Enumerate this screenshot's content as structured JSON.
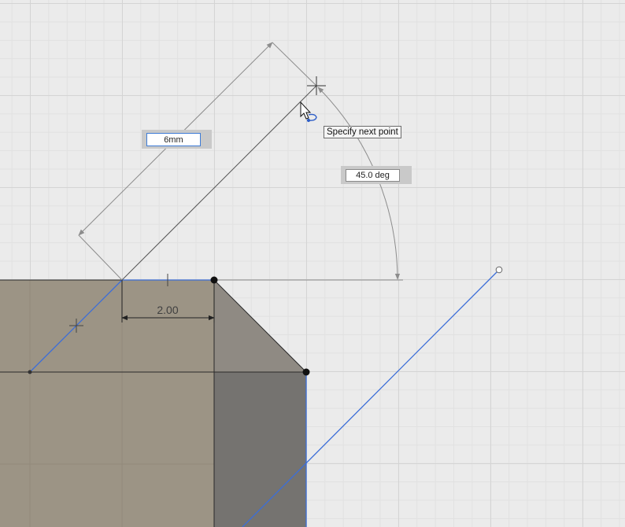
{
  "viewport": {
    "background_color": "#ebebeb",
    "body_face_color": "#988f7f",
    "side_face_color": "#757370",
    "chamfer_face_color": "#8f8a83",
    "sketch_line_color": "#3c6ed8",
    "dimension_line_color": "#8c8c8c"
  },
  "length_input": {
    "value": "6mm"
  },
  "angle_input": {
    "value": "45.0 deg"
  },
  "tooltip": {
    "text": "Specify next point"
  },
  "horizontal_dimension": {
    "label": "2.00"
  },
  "cursor": {
    "icon": "arrow-cursor-icon",
    "badge_icon": "undo-curve-icon"
  }
}
